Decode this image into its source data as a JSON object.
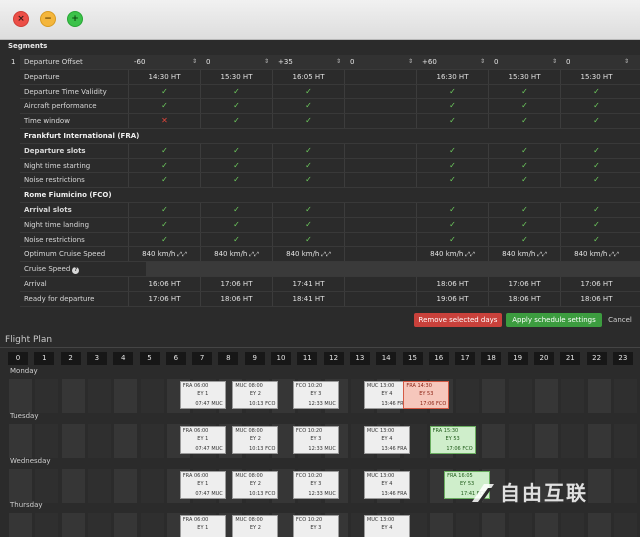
{
  "window": {
    "close": "×",
    "minimize": "−",
    "maximize": "+"
  },
  "segments": {
    "title": "Segments",
    "index": "1",
    "offset_label": "Departure Offset",
    "offsets": [
      "-60",
      "0",
      "+35",
      "0",
      "+60",
      "0",
      "0"
    ],
    "rows": [
      {
        "label": "Departure",
        "type": "text",
        "values": [
          "14:30 HT",
          "15:30 HT",
          "16:05 HT",
          "",
          "16:30 HT",
          "15:30 HT",
          "15:30 HT"
        ]
      },
      {
        "label": "Departure Time Validity",
        "type": "check",
        "values": [
          "ok",
          "ok",
          "ok",
          "",
          "ok",
          "ok",
          "ok"
        ]
      },
      {
        "label": "Aircraft performance",
        "type": "check",
        "values": [
          "ok",
          "ok",
          "ok",
          "",
          "ok",
          "ok",
          "ok"
        ]
      },
      {
        "label": "Time window",
        "type": "check",
        "values": [
          "no",
          "ok",
          "ok",
          "",
          "ok",
          "ok",
          "ok"
        ]
      },
      {
        "label": "Frankfurt International (FRA)",
        "type": "section",
        "values": []
      },
      {
        "label": "Departure slots",
        "type": "check",
        "bold": true,
        "values": [
          "ok",
          "ok",
          "ok",
          "",
          "ok",
          "ok",
          "ok"
        ]
      },
      {
        "label": "Night time starting",
        "type": "check",
        "values": [
          "ok",
          "ok",
          "ok",
          "",
          "ok",
          "ok",
          "ok"
        ]
      },
      {
        "label": "Noise restrictions",
        "type": "check",
        "values": [
          "ok",
          "ok",
          "ok",
          "",
          "ok",
          "ok",
          "ok"
        ]
      },
      {
        "label": "Rome Fiumicino (FCO)",
        "type": "section",
        "values": []
      },
      {
        "label": "Arrival slots",
        "type": "check",
        "bold": true,
        "values": [
          "ok",
          "ok",
          "ok",
          "",
          "ok",
          "ok",
          "ok"
        ]
      },
      {
        "label": "Night time landing",
        "type": "check",
        "values": [
          "ok",
          "ok",
          "ok",
          "",
          "ok",
          "ok",
          "ok"
        ]
      },
      {
        "label": "Noise restrictions",
        "type": "check",
        "values": [
          "ok",
          "ok",
          "ok",
          "",
          "ok",
          "ok",
          "ok"
        ]
      },
      {
        "label": "Optimum Cruise Speed",
        "type": "speed",
        "values": [
          "840 km/h",
          "840 km/h",
          "840 km/h",
          "",
          "840 km/h",
          "840 km/h",
          "840 km/h"
        ]
      },
      {
        "label": "Cruise Speed",
        "type": "cruise",
        "values": []
      },
      {
        "label": "Arrival",
        "type": "text",
        "values": [
          "16:06 HT",
          "17:06 HT",
          "17:41 HT",
          "",
          "18:06 HT",
          "17:06 HT",
          "17:06 HT"
        ]
      },
      {
        "label": "Ready for departure",
        "type": "text",
        "values": [
          "17:06 HT",
          "18:06 HT",
          "18:41 HT",
          "",
          "19:06 HT",
          "18:06 HT",
          "18:06 HT"
        ]
      }
    ]
  },
  "actions": {
    "remove": "Remove selected days",
    "apply": "Apply schedule settings",
    "cancel": "Cancel"
  },
  "flight_plan": {
    "title": "Flight Plan",
    "hours": [
      "0",
      "1",
      "2",
      "3",
      "4",
      "5",
      "6",
      "7",
      "8",
      "9",
      "10",
      "11",
      "12",
      "13",
      "14",
      "15",
      "16",
      "17",
      "18",
      "19",
      "20",
      "21",
      "22",
      "23"
    ],
    "days": [
      {
        "name": "Monday",
        "flights": [
          {
            "dep": "FRA 06:00",
            "code": "EY 1",
            "arr": "07:47 MUC",
            "color": "white",
            "start": 6
          },
          {
            "dep": "MUC 08:00",
            "code": "EY 2",
            "arr": "10:13 FCO",
            "color": "white",
            "start": 8
          },
          {
            "dep": "FCO 10:20",
            "code": "EY 3",
            "arr": "12:33 MUC",
            "color": "white",
            "start": 10.3
          },
          {
            "dep": "MUC 13:00",
            "code": "EY 4",
            "arr": "13:46 FRA",
            "color": "white",
            "start": 13
          },
          {
            "dep": "FRA 14:30",
            "code": "EY 53",
            "arr": "17:06 FCO",
            "color": "red",
            "start": 14.5
          }
        ]
      },
      {
        "name": "Tuesday",
        "flights": [
          {
            "dep": "FRA 06:00",
            "code": "EY 1",
            "arr": "07:47 MUC",
            "color": "white",
            "start": 6
          },
          {
            "dep": "MUC 08:00",
            "code": "EY 2",
            "arr": "10:13 FCO",
            "color": "white",
            "start": 8
          },
          {
            "dep": "FCO 10:20",
            "code": "EY 3",
            "arr": "12:33 MUC",
            "color": "white",
            "start": 10.3
          },
          {
            "dep": "MUC 13:00",
            "code": "EY 4",
            "arr": "13:46 FRA",
            "color": "white",
            "start": 13
          },
          {
            "dep": "FRA 15:30",
            "code": "EY 53",
            "arr": "17:06 FCO",
            "color": "green",
            "start": 15.5
          }
        ]
      },
      {
        "name": "Wednesday",
        "flights": [
          {
            "dep": "FRA 06:00",
            "code": "EY 1",
            "arr": "07:47 MUC",
            "color": "white",
            "start": 6
          },
          {
            "dep": "MUC 08:00",
            "code": "EY 2",
            "arr": "10:13 FCO",
            "color": "white",
            "start": 8
          },
          {
            "dep": "FCO 10:20",
            "code": "EY 3",
            "arr": "12:33 MUC",
            "color": "white",
            "start": 10.3
          },
          {
            "dep": "MUC 13:00",
            "code": "EY 4",
            "arr": "13:46 FRA",
            "color": "white",
            "start": 13
          },
          {
            "dep": "FRA 16:05",
            "code": "EY 53",
            "arr": "17:41 FCO",
            "color": "green",
            "start": 16.05
          }
        ]
      },
      {
        "name": "Thursday",
        "flights": [
          {
            "dep": "FRA 06:00",
            "code": "EY 1",
            "arr": "",
            "color": "white",
            "start": 6
          },
          {
            "dep": "MUC 08:00",
            "code": "EY 2",
            "arr": "",
            "color": "white",
            "start": 8
          },
          {
            "dep": "FCO 10:20",
            "code": "EY 3",
            "arr": "",
            "color": "white",
            "start": 10.3
          },
          {
            "dep": "MUC 13:00",
            "code": "EY 4",
            "arr": "",
            "color": "white",
            "start": 13
          }
        ]
      }
    ]
  },
  "watermark": "自由互联",
  "colors": {
    "ok": "#6fcf5f",
    "no": "#e0453b",
    "remove": "#c9413b",
    "apply": "#3c9c3f"
  }
}
